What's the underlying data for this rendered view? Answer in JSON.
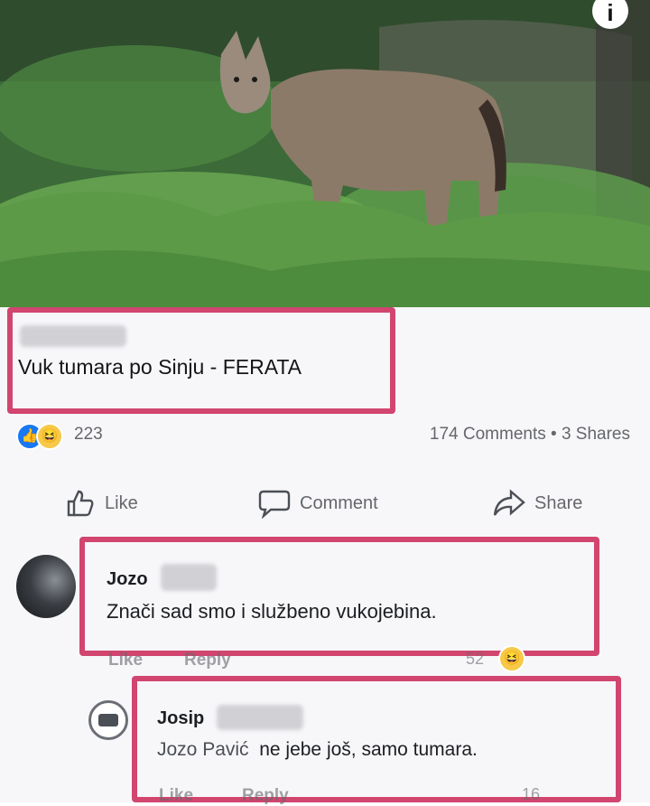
{
  "post": {
    "headline": "Vuk tumara po Sinju - FERATA",
    "reaction_count": "223",
    "comments_shares": "174 Comments • 3 Shares",
    "info_icon": "i"
  },
  "actions": {
    "like": "Like",
    "comment": "Comment",
    "share": "Share"
  },
  "comments": [
    {
      "name": "Jozo",
      "text": "Znači sad smo i službeno vukojebina.",
      "like": "Like",
      "reply": "Reply",
      "count": "52"
    },
    {
      "name": "Josip",
      "mention": "Jozo Pavić",
      "text": "ne jebe još, samo tumara.",
      "like": "Like",
      "reply": "Reply",
      "count": "16"
    }
  ],
  "colors": {
    "highlight": "#d1456f",
    "like_blue": "#1877f2"
  },
  "icons": [
    "info-icon",
    "like-reaction-icon",
    "haha-reaction-icon",
    "thumbs-up-icon",
    "comment-bubble-icon",
    "share-arrow-icon"
  ]
}
